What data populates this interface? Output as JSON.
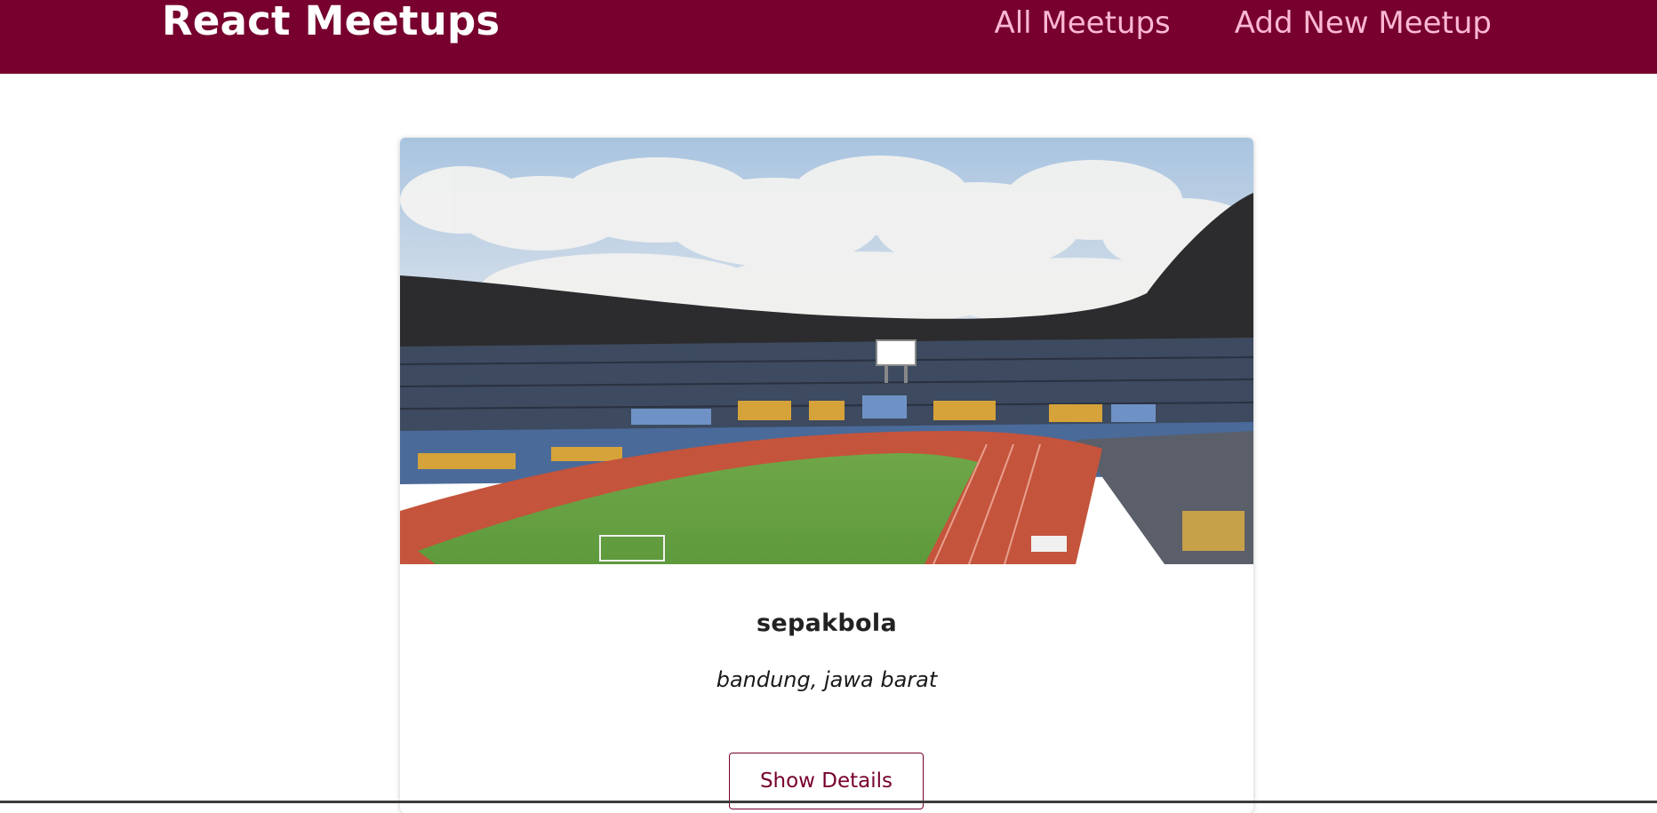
{
  "header": {
    "logo": "React Meetups",
    "nav": [
      {
        "label": "All Meetups"
      },
      {
        "label": "Add New Meetup"
      }
    ]
  },
  "meetup": {
    "title": "sepakbola",
    "address": "bandung, jawa barat",
    "details_button": "Show Details"
  },
  "colors": {
    "header_bg": "#77002e",
    "nav_link": "#fcb8d2",
    "accent": "#77002e"
  }
}
